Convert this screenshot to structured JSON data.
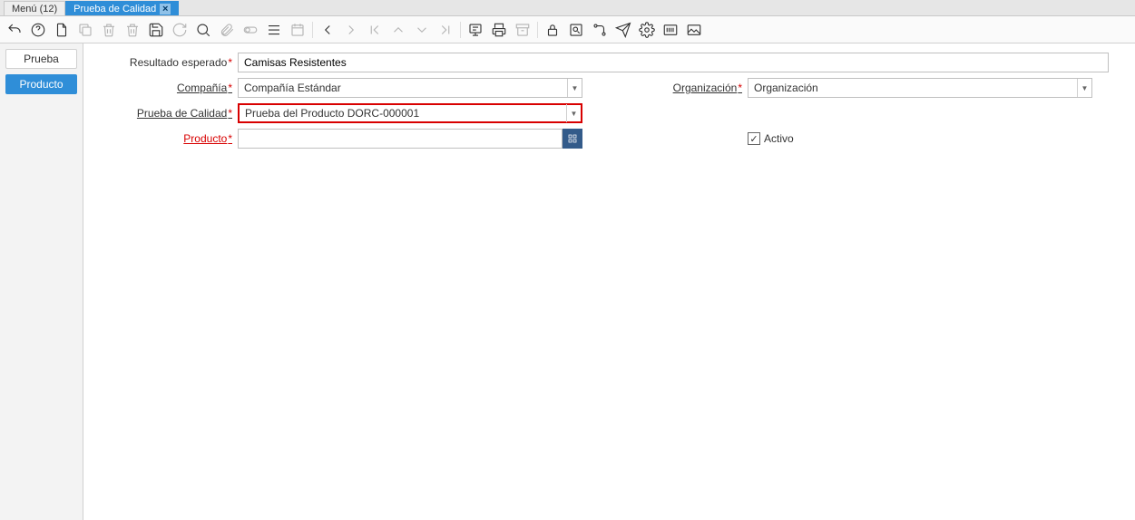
{
  "tabs": {
    "menu": "Menú (12)",
    "active": "Prueba de Calidad"
  },
  "sidebar": {
    "items": [
      "Prueba",
      "Producto"
    ],
    "activeIndex": 1
  },
  "form": {
    "resultado_label": "Resultado esperado",
    "resultado_value": "Camisas Resistentes",
    "compania_label": "Compañía",
    "compania_value": "Compañía Estándar",
    "organizacion_label": "Organización",
    "organizacion_value": "Organización",
    "prueba_label": "Prueba de Calidad",
    "prueba_value": "Prueba del Producto DORC-000001",
    "producto_label": "Producto",
    "producto_value": "",
    "activo_label": "Activo",
    "activo_checked": true
  }
}
